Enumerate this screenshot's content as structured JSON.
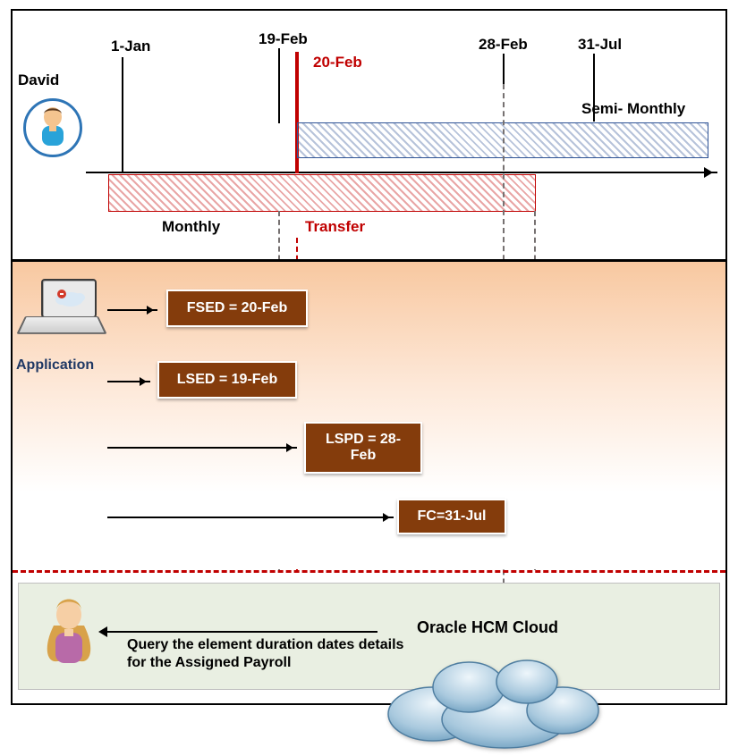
{
  "person_name": "David",
  "timeline": {
    "ticks": {
      "jan1": "1-Jan",
      "feb19": "19-Feb",
      "feb20": "20-Feb",
      "feb28": "28-Feb",
      "jul31": "31-Jul"
    },
    "bars": {
      "monthly": "Monthly",
      "semi": "Semi- Monthly"
    },
    "transfer_label": "Transfer"
  },
  "application_label": "Application",
  "boxes": {
    "fsed": "FSED = 20-Feb",
    "lsed": "LSED = 19-Feb",
    "lspd": "LSPD = 28-\nFeb",
    "fc": "FC=31-Jul"
  },
  "cloud_label": "Oracle HCM Cloud",
  "query_text": "Query the element duration dates details  for the Assigned Payroll"
}
